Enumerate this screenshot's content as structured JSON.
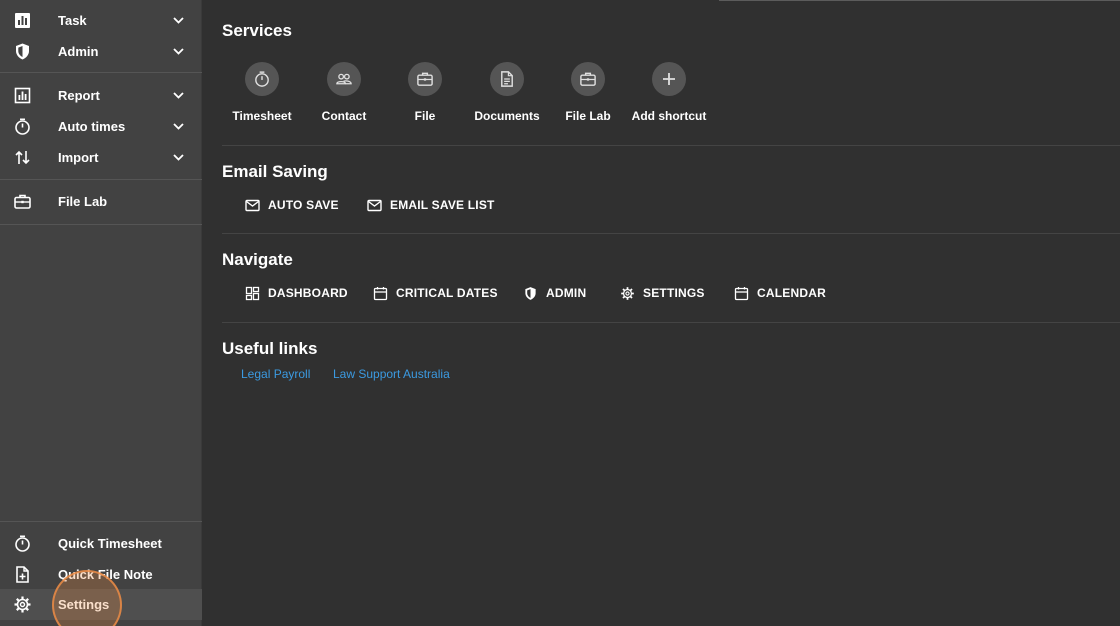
{
  "sidebar": {
    "items": [
      {
        "label": "Task",
        "icon": "bar-chart-icon"
      },
      {
        "label": "Admin",
        "icon": "shield-icon"
      },
      {
        "label": "Report",
        "icon": "report-chart-icon"
      },
      {
        "label": "Auto times",
        "icon": "stopwatch-icon"
      },
      {
        "label": "Import",
        "icon": "import-arrows-icon"
      },
      {
        "label": "File Lab",
        "icon": "briefcase-icon"
      }
    ],
    "bottom": [
      {
        "label": "Quick Timesheet",
        "icon": "stopwatch-icon"
      },
      {
        "label": "Quick File Note",
        "icon": "file-add-icon"
      },
      {
        "label": "Settings",
        "icon": "gear-icon"
      }
    ]
  },
  "main": {
    "services": {
      "title": "Services",
      "shortcuts": [
        {
          "label": "Timesheet",
          "icon": "stopwatch-icon"
        },
        {
          "label": "Contact",
          "icon": "people-icon"
        },
        {
          "label": "File",
          "icon": "briefcase-icon"
        },
        {
          "label": "Documents",
          "icon": "document-icon"
        },
        {
          "label": "File Lab",
          "icon": "briefcase-icon"
        },
        {
          "label": "Add shortcut",
          "icon": "plus-icon"
        }
      ]
    },
    "email_saving": {
      "title": "Email Saving",
      "buttons": [
        {
          "label": "AUTO SAVE",
          "icon": "mail-icon"
        },
        {
          "label": "EMAIL SAVE LIST",
          "icon": "mail-icon"
        }
      ]
    },
    "navigate": {
      "title": "Navigate",
      "buttons": [
        {
          "label": "DASHBOARD",
          "icon": "dashboard-icon"
        },
        {
          "label": "CRITICAL DATES",
          "icon": "calendar-icon"
        },
        {
          "label": "ADMIN",
          "icon": "shield-icon"
        },
        {
          "label": "SETTINGS",
          "icon": "gear-icon"
        },
        {
          "label": "CALENDAR",
          "icon": "calendar-icon"
        }
      ]
    },
    "useful_links": {
      "title": "Useful links",
      "links": [
        {
          "label": "Legal Payroll"
        },
        {
          "label": "Law Support Australia"
        }
      ]
    }
  },
  "colors": {
    "background": "#303030",
    "sidebar": "#424242",
    "link": "#3b9ae1",
    "click_highlight": "#eb8c46"
  }
}
